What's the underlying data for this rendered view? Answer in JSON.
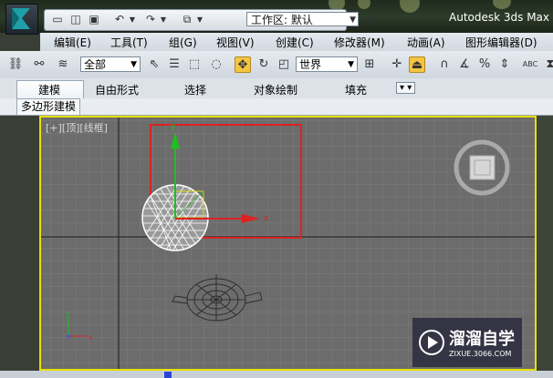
{
  "app": {
    "title": "Autodesk 3ds Max"
  },
  "quick_access": {
    "workspace_label": "工作区: 默认"
  },
  "menu": {
    "items": [
      "编辑(E)",
      "工具(T)",
      "组(G)",
      "视图(V)",
      "创建(C)",
      "修改器(M)",
      "动画(A)",
      "图形编辑器(D)"
    ]
  },
  "toolbar": {
    "selection_filter": "全部",
    "coordinate_system": "世界"
  },
  "ribbon": {
    "tabs": [
      "建模",
      "自由形式",
      "选择",
      "对象绘制",
      "填充"
    ],
    "active_tab": "建模",
    "panel_label": "多边形建模"
  },
  "viewport": {
    "label": "[+][顶][线框]",
    "axis_x_label": "x",
    "axis_y_label": "y"
  },
  "watermark": {
    "text": "溜溜自学",
    "url": "ZIXUE.3066.COM"
  },
  "colors": {
    "viewport_border": "#e8e000",
    "viewport_bg": "#6c6c6c",
    "selection_rect": "#dd2222",
    "gizmo_x": "#dd2222",
    "gizmo_y": "#22aa22"
  }
}
